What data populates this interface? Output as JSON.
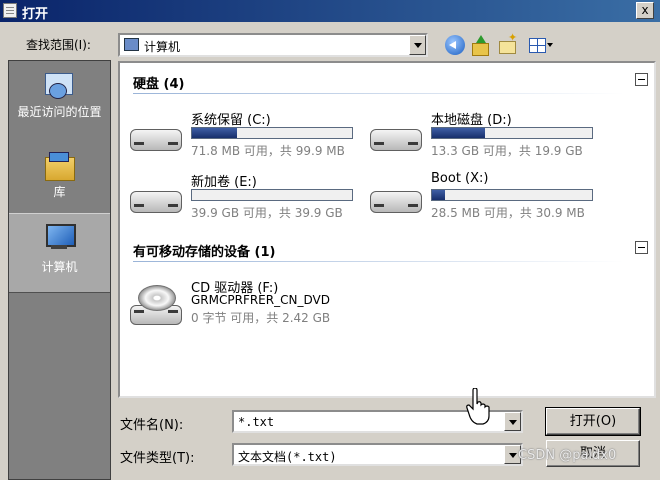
{
  "window": {
    "title": "打开",
    "close_glyph": "x"
  },
  "toolbar": {
    "lookin_label": "查找范围(I):",
    "lookin_value": "计算机"
  },
  "places": [
    {
      "label": "最近访问的位置"
    },
    {
      "label": "库"
    },
    {
      "label": "计算机"
    }
  ],
  "groups": {
    "hard_disks": "硬盘 (4)",
    "removable": "有可移动存储的设备 (1)"
  },
  "drives": [
    {
      "name": "系统保留 (C:)",
      "usage": "71.8 MB 可用，共 99.9 MB",
      "used_fraction": 0.28
    },
    {
      "name": "本地磁盘 (D:)",
      "usage": "13.3 GB 可用，共 19.9 GB",
      "used_fraction": 0.33
    },
    {
      "name": "新加卷 (E:)",
      "usage": "39.9 GB 可用，共 39.9 GB",
      "used_fraction": 0.0
    },
    {
      "name": "Boot (X:)",
      "usage": "28.5 MB 可用，共 30.9 MB",
      "used_fraction": 0.08
    }
  ],
  "cd_drive": {
    "name": "CD 驱动器 (F:)",
    "label": "GRMCPRFRER_CN_DVD",
    "usage": "0 字节 可用，共 2.42 GB"
  },
  "footer": {
    "filename_label": "文件名(N):",
    "filename_value": "*.txt",
    "filetype_label": "文件类型(T):",
    "filetype_value": "文本文档(*.txt)",
    "open_button": "打开(O)",
    "cancel_button": "取消"
  },
  "watermark": "CSDN @paldx0"
}
